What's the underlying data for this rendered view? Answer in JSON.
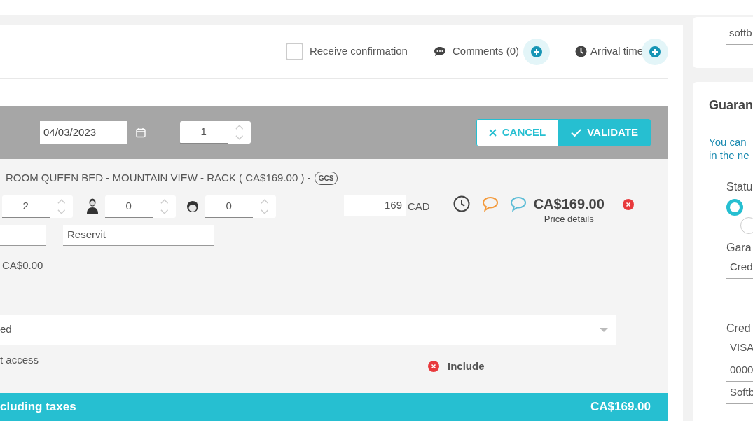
{
  "header": {
    "receive_confirmation": {
      "label": "Receive confirmation",
      "checked": false
    },
    "comments": {
      "label": "Comments (0)"
    },
    "arrival_time": {
      "label": "Arrival time"
    }
  },
  "booking_bar": {
    "date": "04/03/2023",
    "rooms": "1",
    "buttons": [
      {
        "kind": "cancel",
        "label": "CANCEL"
      },
      {
        "kind": "validate",
        "label": "VALIDATE"
      }
    ]
  },
  "room": {
    "title": "ROOM QUEEN BED - MOUNTAIN VIEW - RACK ( CA$169.00 ) -",
    "badge": "GCS",
    "adults": "2",
    "children": "0",
    "babies": "0",
    "rate": "169",
    "currency": "CAD",
    "total": "CA$169.00",
    "price_details": "Price details",
    "source": "Reservit",
    "extra": "CA$0.00",
    "select_value": "ed",
    "option_label": "t access",
    "include": "Include"
  },
  "footer": {
    "label": "cluding taxes",
    "total": "CA$169.00"
  },
  "sidebar": {
    "top_field": "softb",
    "guarantee": {
      "title": "Guaran",
      "info": [
        "You can",
        "in the ne"
      ],
      "status_label": "Statu",
      "status_options": [
        {
          "selected": true
        },
        {
          "selected": false
        }
      ],
      "guarantee_label": "Gara",
      "guarantee_value": "Cred",
      "card_label": "Cred",
      "card_type": "VISA",
      "card_number": "0000",
      "holder": "Softb"
    }
  }
}
